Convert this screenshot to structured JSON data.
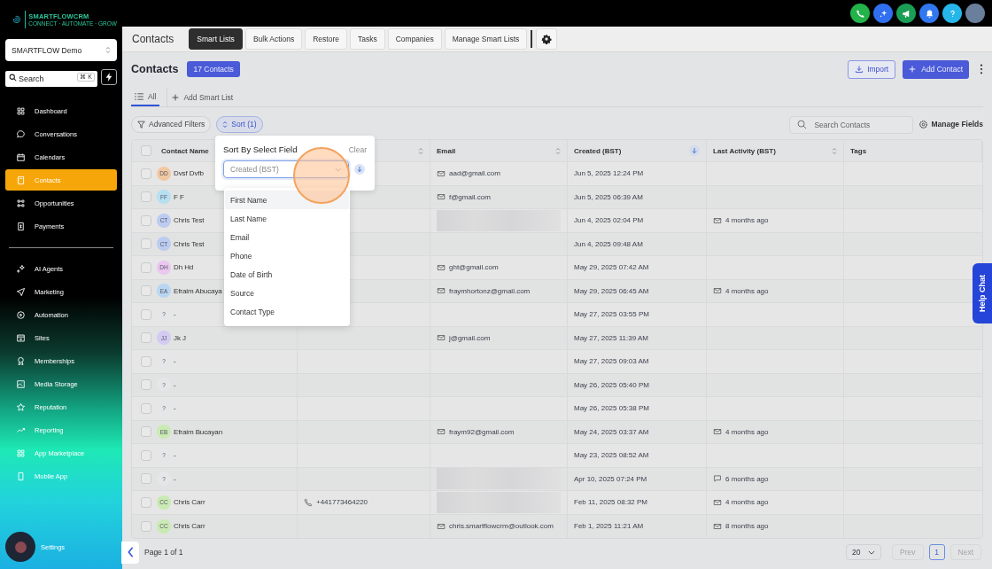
{
  "brand": {
    "name": "SMARTFLOWCRM",
    "tagline": "CONNECT · AUTOMATE · GROW"
  },
  "account_switcher": {
    "value": "SMARTFLOW Demo"
  },
  "sidebar_search": {
    "placeholder": "Search",
    "shortcut": "⌘ K"
  },
  "nav": [
    {
      "label": "Dashboard",
      "selected": false
    },
    {
      "label": "Conversations",
      "selected": false
    },
    {
      "label": "Calendars",
      "selected": false
    },
    {
      "label": "Contacts",
      "selected": true
    },
    {
      "label": "Opportunities",
      "selected": false
    },
    {
      "label": "Payments",
      "selected": false
    }
  ],
  "nav_secondary": [
    {
      "label": "AI Agents",
      "selected": false
    },
    {
      "label": "Marketing",
      "selected": false
    },
    {
      "label": "Automation",
      "selected": false
    },
    {
      "label": "Sites",
      "selected": false
    },
    {
      "label": "Memberships",
      "selected": false
    },
    {
      "label": "Media Storage",
      "selected": false
    },
    {
      "label": "Reputation",
      "selected": false
    },
    {
      "label": "Reporting",
      "selected": false
    },
    {
      "label": "App Marketplace",
      "selected": false
    },
    {
      "label": "Mobile App",
      "selected": false
    }
  ],
  "settings": {
    "label": "Settings"
  },
  "page_title": "Contacts",
  "tabs": [
    {
      "label": "Smart Lists",
      "selected": true
    },
    {
      "label": "Bulk Actions",
      "selected": false
    },
    {
      "label": "Restore",
      "selected": false
    },
    {
      "label": "Tasks",
      "selected": false
    },
    {
      "label": "Companies",
      "selected": false
    },
    {
      "label": "Manage Smart Lists",
      "selected": false
    }
  ],
  "header": {
    "title": "Contacts",
    "count_badge": "17 Contacts",
    "import_button": "Import",
    "add_button": "Add Contact"
  },
  "list_tabs": [
    {
      "label": "All",
      "selected": true
    }
  ],
  "add_list_button": "Add Smart List",
  "filters": {
    "advanced": "Advanced Filters",
    "sort": "Sort (1)",
    "search_placeholder": "Search Contacts",
    "manage_fields": "Manage Fields"
  },
  "table": {
    "all_checked": false,
    "columns": [
      {
        "label": "Contact Name"
      },
      {
        "sortable": true,
        "sorted": false
      },
      {
        "label": "Email",
        "sortable": true,
        "sorted": false
      },
      {
        "label": "Created (BST)",
        "sortable": true,
        "sorted": true
      },
      {
        "label": "Last Activity (BST)",
        "sortable": true,
        "sorted": false
      },
      {
        "label": "Tags"
      }
    ],
    "rows": [
      {
        "checked": false,
        "initials": "DD",
        "color": "#f1c9a1",
        "name": "Dvsf Dvfb",
        "email": "aad@gmail.com",
        "created": "Jun 5, 2025  12:24 PM"
      },
      {
        "checked": false,
        "initials": "FF",
        "color": "#b6e0f2",
        "name": "F F",
        "email": "f@gmail.com",
        "created": "Jun 5, 2025  06:39 AM"
      },
      {
        "checked": false,
        "initials": "CT",
        "color": "#bccbf0",
        "name": "Chris Test",
        "redacted": true,
        "created": "Jun 4, 2025  02:04 PM",
        "activity": {
          "text": "4 months ago",
          "chat": false
        }
      },
      {
        "checked": false,
        "initials": "CT",
        "color": "#bccbf0",
        "name": "Chris Test",
        "created": "Jun 4, 2025  09:48 AM"
      },
      {
        "checked": false,
        "initials": "DH",
        "color": "#ebc6ef",
        "name": "Dh Hd",
        "email": "ght@gmail.com",
        "created": "May 29, 2025  07:42 AM"
      },
      {
        "checked": false,
        "initials": "EA",
        "color": "#b8d6f1",
        "name": "Efraim Abucaya",
        "email": "fraymhortonz@gmail.com",
        "created": "May 29, 2025  06:45 AM",
        "activity": {
          "text": "4 months ago",
          "chat": false
        }
      },
      {
        "checked": false,
        "initials": "?",
        "color": "#e5e6e8",
        "name": "-",
        "created": "May 27, 2025  03:55 PM"
      },
      {
        "checked": false,
        "initials": "JJ",
        "color": "#d3cbf2",
        "name": "Jk J",
        "email": "j@gmail.com",
        "created": "May 27, 2025  11:39 AM"
      },
      {
        "checked": false,
        "initials": "?",
        "color": "#e5e6e8",
        "name": "-",
        "created": "May 27, 2025  09:03 AM"
      },
      {
        "checked": false,
        "initials": "?",
        "color": "#e5e6e8",
        "name": "-",
        "created": "May 26, 2025  05:40 PM"
      },
      {
        "checked": false,
        "initials": "?",
        "color": "#e5e6e8",
        "name": "-",
        "created": "May 26, 2025  05:38 PM"
      },
      {
        "checked": false,
        "initials": "EB",
        "color": "#c9eab3",
        "name": "Efraim Bucayan",
        "email": "fraym92@gmail.com",
        "created": "May 24, 2025  03:37 AM",
        "activity": {
          "text": "4 months ago",
          "chat": false
        }
      },
      {
        "checked": false,
        "initials": "?",
        "color": "#e5e6e8",
        "name": "-",
        "created": "May 23, 2025  08:52 AM"
      },
      {
        "checked": false,
        "initials": "?",
        "color": "#e5e6e8",
        "name": "-",
        "redacted": true,
        "created": "Apr 10, 2025  07:24 PM",
        "activity": {
          "text": "6 months ago",
          "chat": true
        }
      },
      {
        "checked": false,
        "initials": "CC",
        "color": "#c9eab3",
        "name": "Chris Carr",
        "phone": "+441773464220",
        "redacted": true,
        "created": "Feb 11, 2025  08:32 PM",
        "activity": {
          "text": "4 months ago",
          "chat": false
        }
      },
      {
        "checked": false,
        "initials": "CC",
        "color": "#c9eab3",
        "name": "Chris Carr",
        "email": "chris.smartflowcrm@outlook.com",
        "created": "Feb 1, 2025  11:21 AM",
        "activity": {
          "text": "8 months ago",
          "chat": false
        }
      }
    ]
  },
  "sort_popover": {
    "title": "Sort By Select Field",
    "clear": "Clear",
    "field_value": "Created (BST)",
    "options": [
      {
        "label": "First Name",
        "highlighted": true
      },
      {
        "label": "Last Name",
        "highlighted": false
      },
      {
        "label": "Email",
        "highlighted": false
      },
      {
        "label": "Phone",
        "highlighted": false
      },
      {
        "label": "Date of Birth",
        "highlighted": false
      },
      {
        "label": "Source",
        "highlighted": false
      },
      {
        "label": "Contact Type",
        "highlighted": false
      }
    ]
  },
  "pagination": {
    "summary": "Page 1 of 1",
    "page_size": "20",
    "prev": {
      "label": "Prev",
      "disabled": true
    },
    "pages": [
      {
        "label": "1",
        "selected": true
      }
    ],
    "next": {
      "label": "Next",
      "disabled": true
    }
  },
  "help_chat": "Help Chat"
}
